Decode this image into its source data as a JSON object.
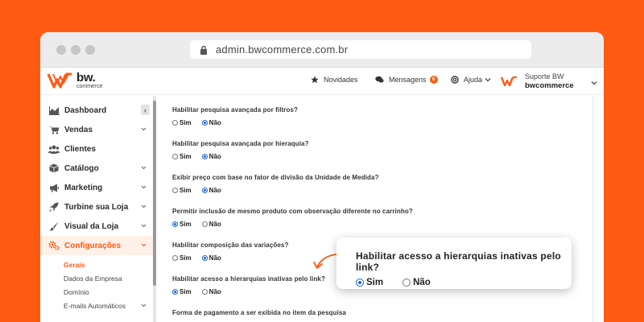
{
  "browser": {
    "url": "admin.bwcommerce.com.br"
  },
  "logo": {
    "brand": "bw.",
    "sub": "commerce"
  },
  "topbar": {
    "news_label": "Novidades",
    "messages_label": "Mensagens",
    "messages_count": "8",
    "help_label": "Ajuda",
    "user_line1": "Suporte BW",
    "user_line2": "bwcommerce"
  },
  "sidebar": {
    "items": [
      {
        "label": "Dashboard",
        "icon": "chart-area-icon"
      },
      {
        "label": "Vendas",
        "icon": "cart-icon"
      },
      {
        "label": "Clientes",
        "icon": "users-icon"
      },
      {
        "label": "Catálogo",
        "icon": "box-icon"
      },
      {
        "label": "Marketing",
        "icon": "megaphone-icon"
      },
      {
        "label": "Turbine sua Loja",
        "icon": "rocket-icon"
      },
      {
        "label": "Visual da Loja",
        "icon": "brush-icon"
      },
      {
        "label": "Configurações",
        "icon": "gears-icon"
      }
    ],
    "subitems": [
      "Gerais",
      "Dados da Empresa",
      "Domínio",
      "E-mails Automáticos"
    ]
  },
  "form": {
    "options": {
      "yes": "Sim",
      "no": "Não"
    },
    "questions": [
      {
        "label": "Habilitar pesquisa avançada por filtros?",
        "value": "Não"
      },
      {
        "label": "Habilitar pesquisa avançada por hieraquia?",
        "value": "Não"
      },
      {
        "label": "Exibir preço com base no fator de divisão da Unidade de Medida?",
        "value": "Não"
      },
      {
        "label": "Permitir inclusão de mesmo produto com observação diferente no carrinho?",
        "value": "Sim"
      },
      {
        "label": "Habilitar composição das variações?",
        "value": "Não"
      },
      {
        "label": "Habilitar acesso a hierarquias inativas pelo link?",
        "value": "Sim"
      }
    ],
    "last_label": "Forma de pagamento a ser exibida no item da pesquisa"
  },
  "callout": {
    "label": "Habilitar acesso a hierarquias inativas pelo link?",
    "yes": "Sim",
    "no": "Não",
    "value": "Sim"
  },
  "colors": {
    "brand": "#ff5a14",
    "radio": "#1a64d6"
  }
}
